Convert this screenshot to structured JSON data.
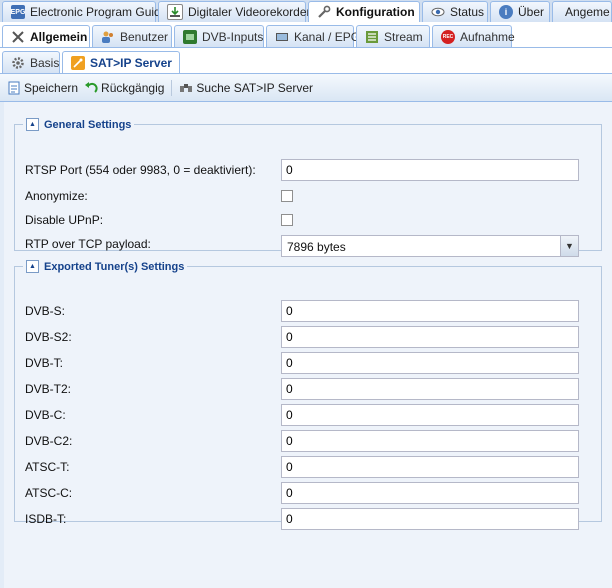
{
  "tabs_main": [
    {
      "label": "Electronic Program Guide",
      "icon": "epg-icon",
      "active": false
    },
    {
      "label": "Digitaler Videorekorder",
      "icon": "download-icon",
      "active": false
    },
    {
      "label": "Konfiguration",
      "icon": "wrench-icon",
      "active": true
    },
    {
      "label": "Status",
      "icon": "eye-icon",
      "active": false
    },
    {
      "label": "Über",
      "icon": "info-icon",
      "active": false
    },
    {
      "label": "Angeme",
      "active": false
    }
  ],
  "tabs_config": [
    {
      "label": "Allgemein",
      "icon": "tools-icon",
      "active": true
    },
    {
      "label": "Benutzer",
      "icon": "users-icon",
      "active": false
    },
    {
      "label": "DVB-Inputs",
      "icon": "card-icon",
      "active": false
    },
    {
      "label": "Kanal / EPG",
      "icon": "tv-icon",
      "active": false
    },
    {
      "label": "Stream",
      "icon": "stream-icon",
      "active": false
    },
    {
      "label": "Aufnahme",
      "icon": "rec-icon",
      "active": false
    }
  ],
  "tabs_general": [
    {
      "label": "Basis",
      "icon": "gear-icon",
      "active": false
    },
    {
      "label": "SAT>IP Server",
      "icon": "satellite-icon",
      "active": true
    }
  ],
  "toolbar": {
    "save_label": "Speichern",
    "undo_label": "Rückgängig",
    "search_label": "Suche SAT>IP Server"
  },
  "general": {
    "legend": "General Settings",
    "rtsp_label": "RTSP Port (554 oder 9983, 0 = deaktiviert):",
    "rtsp_value": "0",
    "anonymize_label": "Anonymize:",
    "anonymize_checked": false,
    "upnp_label": "Disable UPnP:",
    "upnp_checked": false,
    "rtp_label": "RTP over TCP payload:",
    "rtp_value": "7896 bytes"
  },
  "tuners": {
    "legend": "Exported Tuner(s) Settings",
    "rows": [
      {
        "label": "DVB-S:",
        "value": "0"
      },
      {
        "label": "DVB-S2:",
        "value": "0"
      },
      {
        "label": "DVB-T:",
        "value": "0"
      },
      {
        "label": "DVB-T2:",
        "value": "0"
      },
      {
        "label": "DVB-C:",
        "value": "0"
      },
      {
        "label": "DVB-C2:",
        "value": "0"
      },
      {
        "label": "ATSC-T:",
        "value": "0"
      },
      {
        "label": "ATSC-C:",
        "value": "0"
      },
      {
        "label": "ISDB-T:",
        "value": "0"
      }
    ]
  }
}
